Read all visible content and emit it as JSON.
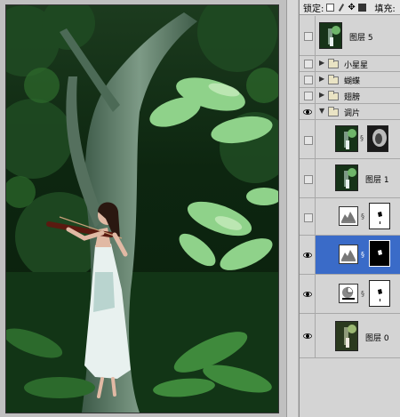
{
  "toolbar": {
    "lock_label": "锁定:",
    "fill_label": "填充:",
    "lock_icons": [
      "lock-transparent-icon",
      "lock-paint-icon",
      "lock-move-icon",
      "lock-all-icon"
    ]
  },
  "layers": [
    {
      "kind": "layer",
      "name": "图层 5",
      "visible": false,
      "selected": false,
      "thumb": "photo"
    },
    {
      "kind": "group",
      "name": "小星星",
      "visible": false,
      "expanded": false
    },
    {
      "kind": "group",
      "name": "蝴蝶",
      "visible": false,
      "expanded": false
    },
    {
      "kind": "group",
      "name": "翅膀",
      "visible": false,
      "expanded": false
    },
    {
      "kind": "group",
      "name": "调片",
      "visible": true,
      "expanded": true
    },
    {
      "kind": "layer",
      "name": "",
      "visible": false,
      "selected": false,
      "thumb": "photo",
      "mask": "dark"
    },
    {
      "kind": "layer",
      "name": "图层 1",
      "visible": false,
      "selected": false,
      "thumb": "photo"
    },
    {
      "kind": "adjustment",
      "name": "",
      "visible": false,
      "selected": false,
      "adj": "levels-icon",
      "mask": "white"
    },
    {
      "kind": "adjustment",
      "name": "",
      "visible": true,
      "selected": true,
      "adj": "levels-icon",
      "mask": "black"
    },
    {
      "kind": "adjustment",
      "name": "",
      "visible": true,
      "selected": false,
      "adj": "channel-mixer-icon",
      "mask": "white"
    },
    {
      "kind": "layer",
      "name": "图层 0",
      "visible": true,
      "selected": false,
      "thumb": "photo"
    }
  ],
  "colors": {
    "selection": "#3a6bc8",
    "panel_bg": "#d4d4d4",
    "photo_dark": "#0f2a10",
    "photo_light": "#8fc98a"
  }
}
